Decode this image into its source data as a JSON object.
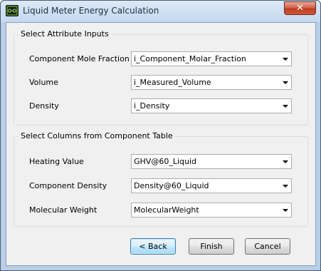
{
  "window": {
    "title": "Liquid Meter Energy Calculation",
    "close_label": "✕"
  },
  "attribute_group": {
    "title": "Select Attribute Inputs",
    "fields": [
      {
        "label": "Component Mole Fraction",
        "value": "i_Component_Molar_Fraction"
      },
      {
        "label": "Volume",
        "value": "i_Measured_Volume"
      },
      {
        "label": "Density",
        "value": "i_Density"
      }
    ]
  },
  "columns_group": {
    "title": "Select Columns from Component Table",
    "fields": [
      {
        "label": "Heating Value",
        "value": "GHV@60_Liquid"
      },
      {
        "label": "Component Density",
        "value": "Density@60_Liquid"
      },
      {
        "label": "Molecular Weight",
        "value": "MolecularWeight"
      }
    ]
  },
  "buttons": {
    "back": "< Back",
    "finish": "Finish",
    "cancel": "Cancel"
  },
  "icons": {
    "app": "meter-icon",
    "dropdown": "chevron-down-icon",
    "close": "close-icon"
  }
}
